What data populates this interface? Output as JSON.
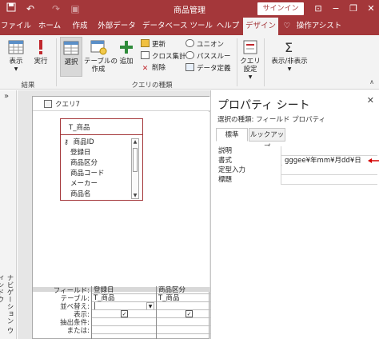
{
  "titlebar": {
    "title": "商品管理",
    "signin": "サインイン",
    "minimize": "−",
    "restore": "❐",
    "close": "✕",
    "qat_icons": [
      "save-icon",
      "undo-icon",
      "redo-icon",
      "customize-icon"
    ]
  },
  "tabs": [
    "ファイル",
    "ホーム",
    "作成",
    "外部データ",
    "データベース ツール",
    "ヘルプ",
    "デザイン",
    "操作アシスト"
  ],
  "active_tab": "デザイン",
  "ribbon": {
    "view": "表示",
    "run": "実行",
    "select": "選択",
    "make_table": "テーブルの\n作成",
    "append": "追加",
    "update": "更新",
    "crosstab": "クロス集計",
    "delete": "削除",
    "union": "ユニオン",
    "passthrough": "パススルー",
    "data_def": "データ定義",
    "query_setup": "クエリ\n設定",
    "show_hide": "表示/非表示",
    "group_results": "結果",
    "group_query_type": "クエリの種類"
  },
  "navpane": {
    "label": "ナビゲーション ウィンドウ",
    "chevron": "»"
  },
  "query": {
    "tab_label": "クエリ7",
    "table": {
      "title": "T_商品",
      "fields": [
        "商品ID",
        "登録日",
        "商品区分",
        "商品コード",
        "メーカー",
        "商品名"
      ]
    },
    "grid": {
      "row_labels": [
        "フィールド:",
        "テーブル:",
        "並べ替え:",
        "表示:",
        "抽出条件:",
        "または:"
      ],
      "columns": [
        {
          "field": "登録日",
          "table": "T_商品",
          "sort": "",
          "show": true
        },
        {
          "field": "商品区分",
          "table": "T_商品",
          "sort": "",
          "show": true
        }
      ]
    }
  },
  "props": {
    "title": "プロパティ シート",
    "selection": "選択の種類:  フィールド プロパティ",
    "tabs": [
      "標準",
      "ルックアップ"
    ],
    "active_tab": "標準",
    "rows": [
      {
        "label": "説明",
        "value": ""
      },
      {
        "label": "書式",
        "value": "gggee¥年mm¥月dd¥日"
      },
      {
        "label": "定型入力",
        "value": ""
      },
      {
        "label": "標題",
        "value": ""
      }
    ]
  },
  "colors": {
    "accent": "#a4373a",
    "ribbon": "#f3f3f3",
    "arrow": "#d40000"
  }
}
